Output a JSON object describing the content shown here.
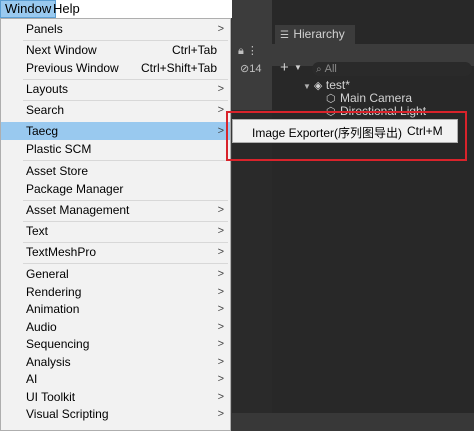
{
  "menubar": {
    "window": "Window",
    "help": "Help"
  },
  "menu": {
    "items": [
      {
        "label": "Panels",
        "submenu": true
      },
      {
        "label": "Next Window",
        "shortcut": "Ctrl+Tab"
      },
      {
        "label": "Previous Window",
        "shortcut": "Ctrl+Shift+Tab"
      },
      {
        "label": "Layouts",
        "submenu": true
      },
      {
        "label": "Search",
        "submenu": true
      },
      {
        "label": "Taecg",
        "submenu": true,
        "highlighted": true
      },
      {
        "label": "Plastic SCM"
      },
      {
        "label": "Asset Store"
      },
      {
        "label": "Package Manager"
      },
      {
        "label": "Asset Management",
        "submenu": true
      },
      {
        "label": "Text",
        "submenu": true
      },
      {
        "label": "TextMeshPro",
        "submenu": true
      },
      {
        "label": "General",
        "submenu": true
      },
      {
        "label": "Rendering",
        "submenu": true
      },
      {
        "label": "Animation",
        "submenu": true
      },
      {
        "label": "Audio",
        "submenu": true
      },
      {
        "label": "Sequencing",
        "submenu": true
      },
      {
        "label": "Analysis",
        "submenu": true
      },
      {
        "label": "AI",
        "submenu": true
      },
      {
        "label": "UI Toolkit",
        "submenu": true
      },
      {
        "label": "Visual Scripting",
        "submenu": true
      }
    ]
  },
  "submenu": {
    "label": "Image Exporter(序列图导出)",
    "shortcut": "Ctrl+M"
  },
  "hierarchy": {
    "tab_label": "Hierarchy",
    "search_placeholder": "All",
    "visibility_count": "14",
    "scene": "test*",
    "objects": [
      "Main Camera",
      "Directional Light"
    ]
  },
  "colors": {
    "highlight": "#99c9ef",
    "annotation": "#d9232b",
    "editor_bg": "#383838"
  }
}
